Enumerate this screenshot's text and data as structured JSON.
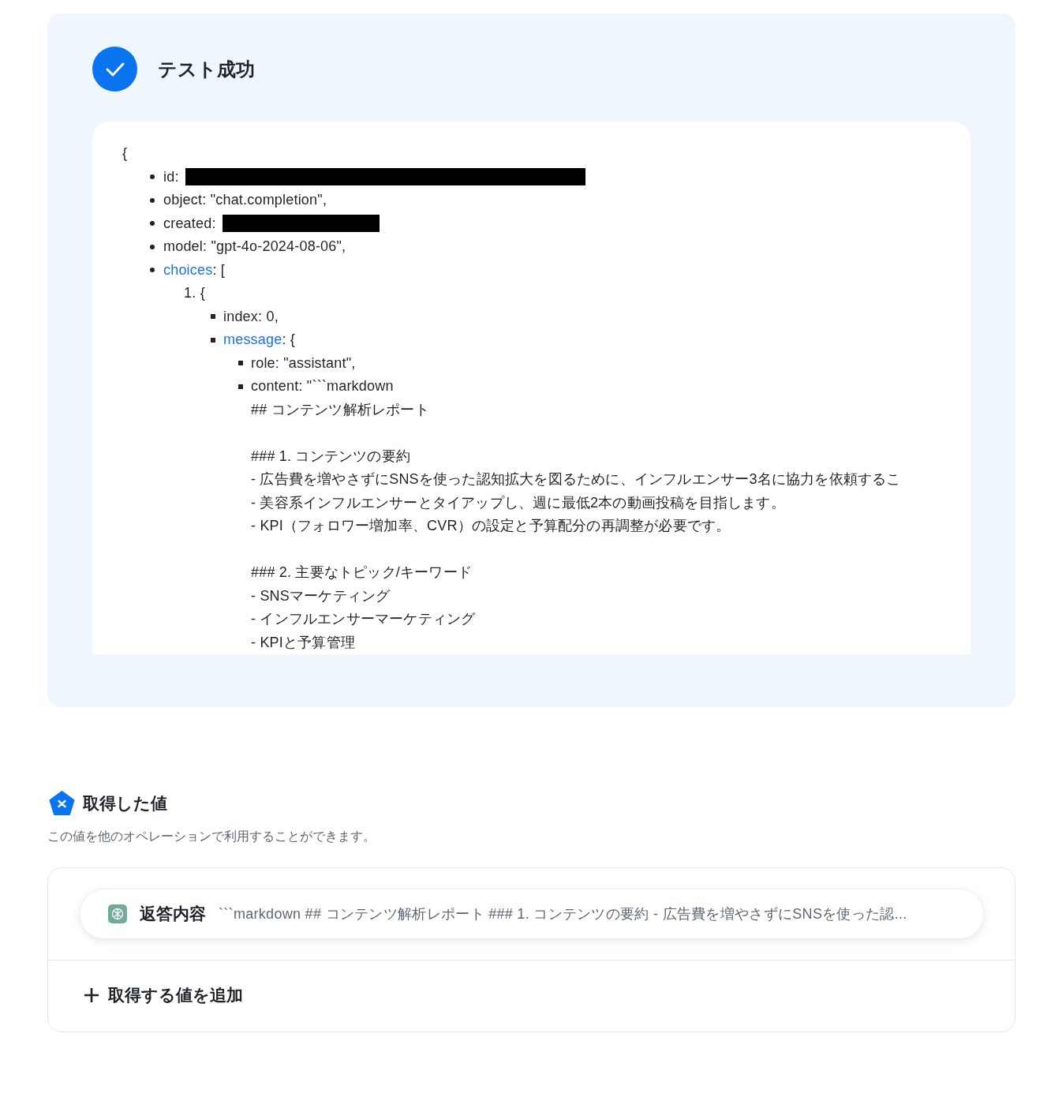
{
  "result": {
    "succeeded": true,
    "title": "テスト成功",
    "code": {
      "open": "{",
      "fields": [
        {
          "text": "id:",
          "redacted": true,
          "wide": true
        },
        {
          "text": "object: \"chat.completion\","
        },
        {
          "text": "created:",
          "redacted": true,
          "wide": false
        },
        {
          "text": "model: \"gpt-4o-2024-08-06\","
        },
        {
          "link": "choices",
          "text": ": [",
          "items": [
            {
              "marker": "1.",
              "open": "{",
              "fields": [
                {
                  "text": "index: 0,"
                },
                {
                  "link": "message",
                  "text": ": {",
                  "fields": [
                    {
                      "text": "role: \"assistant\","
                    },
                    {
                      "text": "content: \"```markdown",
                      "blocks": [
                        [
                          "## コンテンツ解析レポート"
                        ],
                        [
                          "### 1. コンテンツの要約",
                          "- 広告費を増やさずにSNSを使った認知拡大を図るために、インフルエンサー3名に協力を依頼するこ",
                          "- 美容系インフルエンサーとタイアップし、週に最低2本の動画投稿を目指します。",
                          "- KPI（フォロワー増加率、CVR）の設定と予算配分の再調整が必要です。"
                        ],
                        [
                          "### 2. 主要なトピック/キーワード",
                          "- SNSマーケティング",
                          "- インフルエンサーマーケティング",
                          "- KPIと予算管理"
                        ]
                      ]
                    }
                  ]
                }
              ]
            }
          ]
        }
      ]
    }
  },
  "values": {
    "title": "取得した値",
    "description": "この値を他のオペレーションで利用することができます。",
    "items": [
      {
        "label": "返答内容",
        "value": "```markdown ## コンテンツ解析レポート ### 1. コンテンツの要約 - 広告費を増やさずにSNSを使った認..."
      }
    ],
    "add_button": "取得する値を追加"
  }
}
